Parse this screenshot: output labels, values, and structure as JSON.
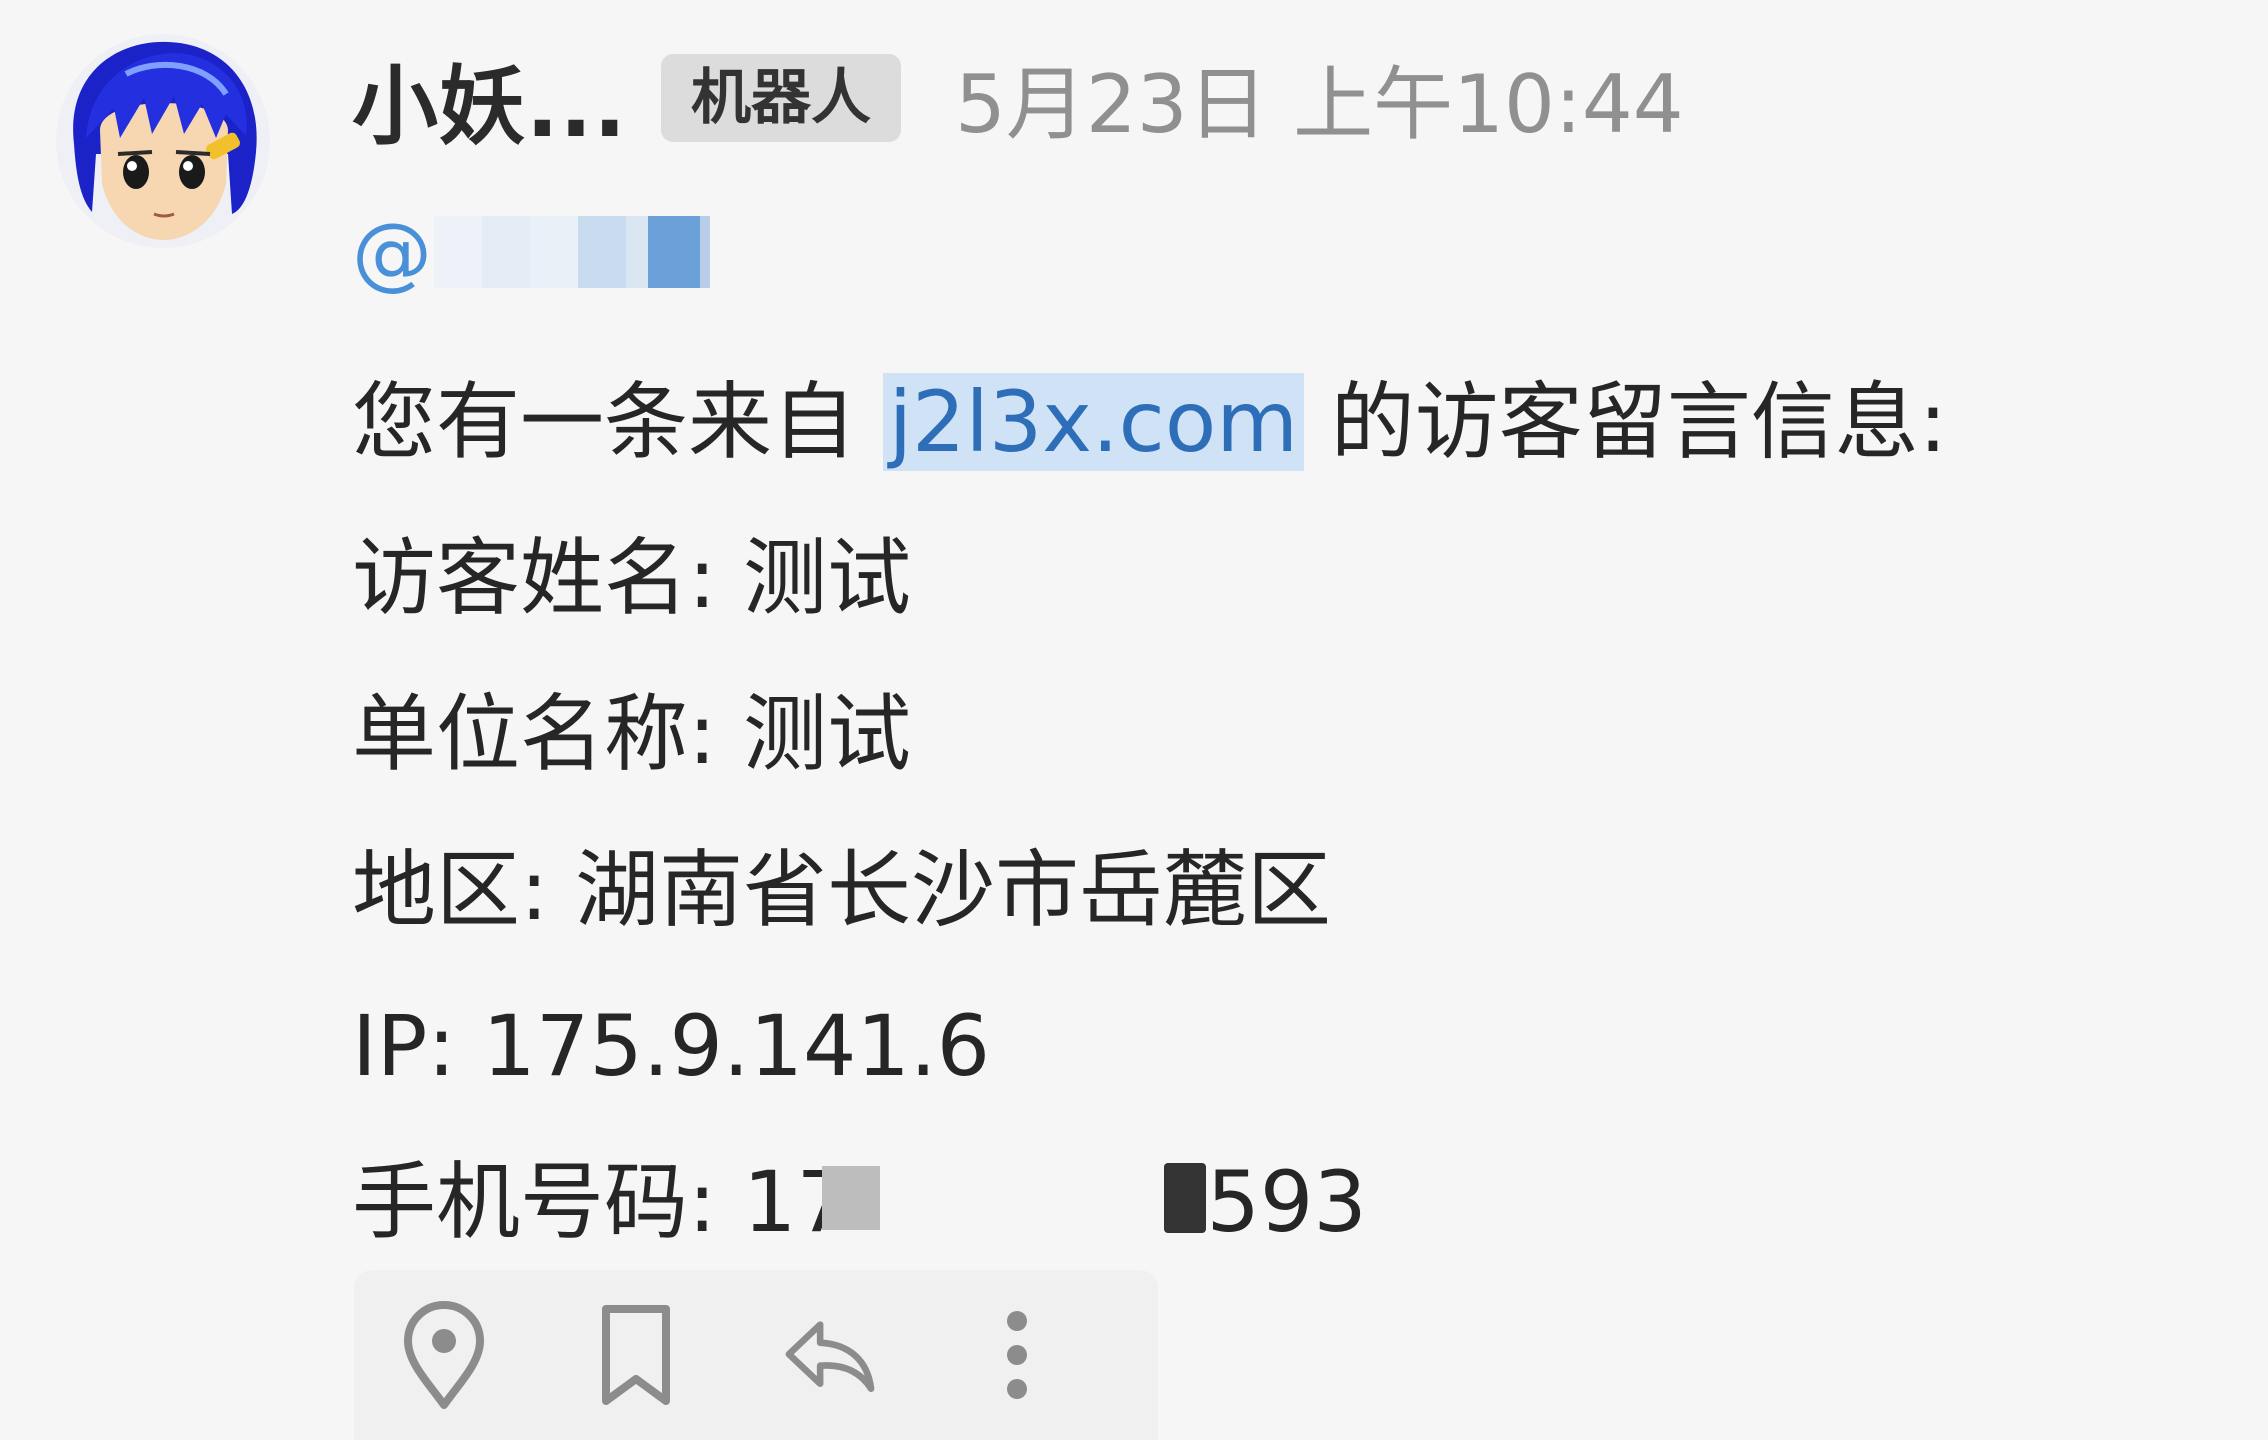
{
  "message": {
    "sender_name": "小妖...",
    "bot_badge": "机器人",
    "timestamp": "5月23日 上午10:44",
    "mention_prefix": "@",
    "intro_before": "您有一条来自 ",
    "intro_link": "j2l3x.com",
    "intro_after": " 的访客留言信息:",
    "visitor_name_line": "访客姓名: 测试",
    "company_line": "单位名称: 测试",
    "region_line": "地区: 湖南省长沙市岳麓区",
    "ip_line": "IP: 175.9.141.6",
    "phone_label": "手机号码: 1",
    "phone_digit_partial": "7",
    "phone_suffix": "593"
  },
  "actions": [
    {
      "icon": "location-pin-icon"
    },
    {
      "icon": "bookmark-icon"
    },
    {
      "icon": "reply-icon"
    },
    {
      "icon": "more-vertical-icon"
    }
  ],
  "colors": {
    "background": "#f6f6f6",
    "link_text": "#2e6db8",
    "link_highlight": "#cfe2f6",
    "mention": "#4a90d8",
    "timestamp": "#909090",
    "badge_bg": "#dcdcdc",
    "icon_gray": "#8c8c8c"
  }
}
